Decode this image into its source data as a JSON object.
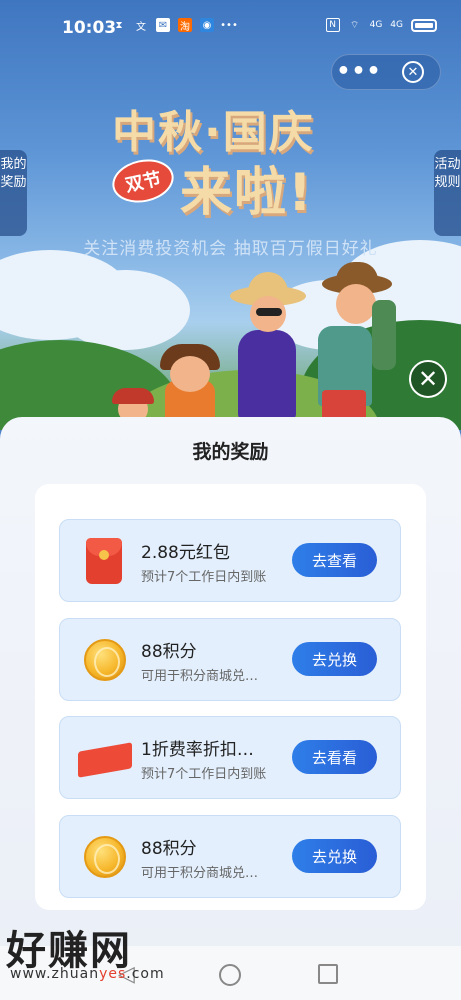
{
  "status_bar": {
    "time": "10:03",
    "network_label": "4G",
    "network_label_2": "4G"
  },
  "capsule": {
    "more_label": "•••",
    "close_label": "✕"
  },
  "side_tabs": {
    "left": "我的奖励",
    "right": "活动规则"
  },
  "banner": {
    "title_line1": "中秋·国庆",
    "badge": "双节",
    "title_line2": "来啦!",
    "slogan": "关注消费投资机会 抽取百万假日好礼"
  },
  "overlay_close_label": "✕",
  "sheet": {
    "title": "我的奖励",
    "rewards": [
      {
        "icon": "red-envelope-icon",
        "title": "2.88元红包",
        "desc": "预计7个工作日内到账",
        "button": "去查看"
      },
      {
        "icon": "gold-coin-icon",
        "title": "88积分",
        "desc": "可用于积分商城兑…",
        "button": "去兑换"
      },
      {
        "icon": "coupon-ticket-icon",
        "title": "1折费率折扣…",
        "desc": "预计7个工作日内到账",
        "button": "去看看"
      },
      {
        "icon": "gold-coin-icon",
        "title": "88积分",
        "desc": "可用于积分商城兑…",
        "button": "去兑换"
      }
    ]
  },
  "watermark": {
    "brand": "好赚网",
    "url_prefix": "www.zhuan",
    "url_highlight": "yes",
    "url_suffix": ".com"
  },
  "colors": {
    "primary_button": "#2e6ee0",
    "row_bg": "#e3effc",
    "red_envelope": "#e4402f",
    "coin": "#f6b72b"
  }
}
